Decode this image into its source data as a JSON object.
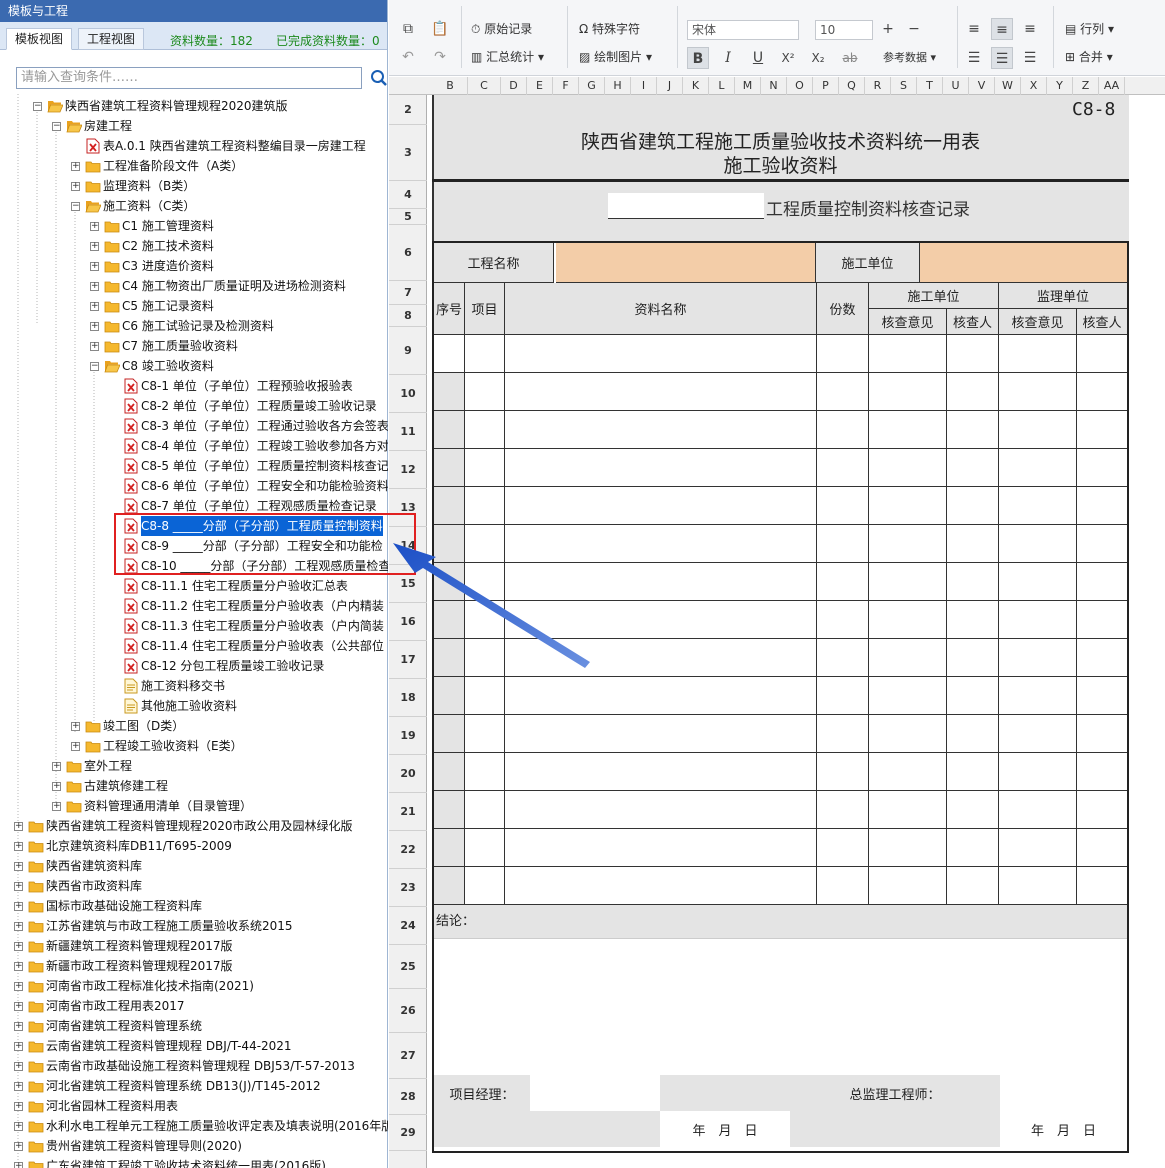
{
  "left_panel": {
    "title": "模板与工程",
    "tabs": [
      "模板视图",
      "工程视图"
    ],
    "data_count": "资料数量：182",
    "done_count": "已完成资料数量：0",
    "search_placeholder": "请输入查询条件……"
  },
  "tree": [
    {
      "label": "陕西省建筑工程资料管理规程2020建筑版",
      "level": 1,
      "expander": "minus",
      "icon": "folder-open"
    },
    {
      "label": "房建工程",
      "level": 2,
      "expander": "minus",
      "icon": "folder-open"
    },
    {
      "label": "表A.0.1 陕西省建筑工程资料整编目录一房建工程",
      "level": 3,
      "expander": "none",
      "icon": "doc-red"
    },
    {
      "label": "工程准备阶段文件（A类）",
      "level": 3,
      "expander": "plus",
      "icon": "folder"
    },
    {
      "label": "监理资料（B类）",
      "level": 3,
      "expander": "plus",
      "icon": "folder"
    },
    {
      "label": "施工资料（C类）",
      "level": 3,
      "expander": "minus",
      "icon": "folder-open"
    },
    {
      "label": "C1 施工管理资料",
      "level": 4,
      "expander": "plus",
      "icon": "folder"
    },
    {
      "label": "C2 施工技术资料",
      "level": 4,
      "expander": "plus",
      "icon": "folder"
    },
    {
      "label": "C3 进度造价资料",
      "level": 4,
      "expander": "plus",
      "icon": "folder"
    },
    {
      "label": "C4 施工物资出厂质量证明及进场检测资料",
      "level": 4,
      "expander": "plus",
      "icon": "folder"
    },
    {
      "label": "C5 施工记录资料",
      "level": 4,
      "expander": "plus",
      "icon": "folder"
    },
    {
      "label": "C6 施工试验记录及检测资料",
      "level": 4,
      "expander": "plus",
      "icon": "folder"
    },
    {
      "label": "C7 施工质量验收资料",
      "level": 4,
      "expander": "plus",
      "icon": "folder"
    },
    {
      "label": "C8 竣工验收资料",
      "level": 4,
      "expander": "minus",
      "icon": "folder-open"
    },
    {
      "label": "C8-1 单位（子单位）工程预验收报验表",
      "level": 5,
      "expander": "none",
      "icon": "doc-red"
    },
    {
      "label": "C8-2 单位（子单位）工程质量竣工验收记录",
      "level": 5,
      "expander": "none",
      "icon": "doc-red"
    },
    {
      "label": "C8-3 单位（子单位）工程通过验收各方会签表",
      "level": 5,
      "expander": "none",
      "icon": "doc-red"
    },
    {
      "label": "C8-4 单位（子单位）工程竣工验收参加各方对",
      "level": 5,
      "expander": "none",
      "icon": "doc-red"
    },
    {
      "label": "C8-5 单位（子单位）工程质量控制资料核查记",
      "level": 5,
      "expander": "none",
      "icon": "doc-red"
    },
    {
      "label": "C8-6 单位（子单位）工程安全和功能检验资料",
      "level": 5,
      "expander": "none",
      "icon": "doc-red"
    },
    {
      "label": "C8-7 单位（子单位）工程观感质量检查记录",
      "level": 5,
      "expander": "none",
      "icon": "doc-red"
    },
    {
      "label": "C8-8 _____分部（子分部）工程质量控制资料",
      "level": 5,
      "expander": "none",
      "icon": "doc-red",
      "selected": true
    },
    {
      "label": "C8-9 _____分部（子分部）工程安全和功能检",
      "level": 5,
      "expander": "none",
      "icon": "doc-red"
    },
    {
      "label": "C8-10 _____分部（子分部）工程观感质量检查",
      "level": 5,
      "expander": "none",
      "icon": "doc-red"
    },
    {
      "label": "C8-11.1 住宅工程质量分户验收汇总表",
      "level": 5,
      "expander": "none",
      "icon": "doc-red"
    },
    {
      "label": "C8-11.2 住宅工程质量分户验收表（户内精装",
      "level": 5,
      "expander": "none",
      "icon": "doc-red"
    },
    {
      "label": "C8-11.3 住宅工程质量分户验收表（户内简装",
      "level": 5,
      "expander": "none",
      "icon": "doc-red"
    },
    {
      "label": "C8-11.4 住宅工程质量分户验收表（公共部位",
      "level": 5,
      "expander": "none",
      "icon": "doc-red"
    },
    {
      "label": "C8-12 分包工程质量竣工验收记录",
      "level": 5,
      "expander": "none",
      "icon": "doc-red"
    },
    {
      "label": "施工资料移交书",
      "level": 5,
      "expander": "none",
      "icon": "doc-yellow"
    },
    {
      "label": "其他施工验收资料",
      "level": 5,
      "expander": "none",
      "icon": "doc-yellow"
    },
    {
      "label": "竣工图（D类）",
      "level": 3,
      "expander": "plus",
      "icon": "folder"
    },
    {
      "label": "工程竣工验收资料（E类）",
      "level": 3,
      "expander": "plus",
      "icon": "folder"
    },
    {
      "label": "室外工程",
      "level": 2,
      "expander": "plus",
      "icon": "folder"
    },
    {
      "label": "古建筑修建工程",
      "level": 2,
      "expander": "plus",
      "icon": "folder"
    },
    {
      "label": "资料管理通用清单（目录管理）",
      "level": 2,
      "expander": "plus",
      "icon": "folder"
    },
    {
      "label": "陕西省建筑工程资料管理规程2020市政公用及园林绿化版",
      "level": 0,
      "expander": "plus",
      "icon": "folder"
    },
    {
      "label": "北京建筑资料库DB11/T695-2009",
      "level": 0,
      "expander": "plus",
      "icon": "folder"
    },
    {
      "label": "陕西省建筑资料库",
      "level": 0,
      "expander": "plus",
      "icon": "folder"
    },
    {
      "label": "陕西省市政资料库",
      "level": 0,
      "expander": "plus",
      "icon": "folder"
    },
    {
      "label": "国标市政基础设施工程资料库",
      "level": 0,
      "expander": "plus",
      "icon": "folder"
    },
    {
      "label": "江苏省建筑与市政工程施工质量验收系统2015",
      "level": 0,
      "expander": "plus",
      "icon": "folder"
    },
    {
      "label": "新疆建筑工程资料管理规程2017版",
      "level": 0,
      "expander": "plus",
      "icon": "folder"
    },
    {
      "label": "新疆市政工程资料管理规程2017版",
      "level": 0,
      "expander": "plus",
      "icon": "folder"
    },
    {
      "label": "河南省市政工程标准化技术指南(2021)",
      "level": 0,
      "expander": "plus",
      "icon": "folder"
    },
    {
      "label": "河南省市政工程用表2017",
      "level": 0,
      "expander": "plus",
      "icon": "folder"
    },
    {
      "label": "河南省建筑工程资料管理系统",
      "level": 0,
      "expander": "plus",
      "icon": "folder"
    },
    {
      "label": "云南省建筑工程资料管理规程 DBJ/T-44-2021",
      "level": 0,
      "expander": "plus",
      "icon": "folder"
    },
    {
      "label": "云南省市政基础设施工程资料管理规程 DBJ53/T-57-2013",
      "level": 0,
      "expander": "plus",
      "icon": "folder"
    },
    {
      "label": "河北省建筑工程资料管理系统 DB13(J)/T145-2012",
      "level": 0,
      "expander": "plus",
      "icon": "folder"
    },
    {
      "label": "河北省园林工程资料用表",
      "level": 0,
      "expander": "plus",
      "icon": "folder"
    },
    {
      "label": "水利水电工程单元工程施工质量验收评定表及填表说明(2016年版",
      "level": 0,
      "expander": "plus",
      "icon": "folder"
    },
    {
      "label": "贵州省建筑工程资料管理导则(2020)",
      "level": 0,
      "expander": "plus",
      "icon": "folder"
    },
    {
      "label": "广东省建筑工程竣工验收技术资料统一用表(2016版)",
      "level": 0,
      "expander": "plus",
      "icon": "folder"
    }
  ],
  "toolbar": {
    "original_record": "原始记录",
    "special_char": "特殊字符",
    "summary_stats": "汇总统计",
    "draw_image": "绘制图片",
    "font_name": "宋体",
    "font_size": "10",
    "reference_data": "参考数据",
    "row_col": "行列",
    "merge": "合并",
    "bold": "B",
    "italic": "I",
    "underline": "U",
    "superscript": "X²",
    "subscript": "X₂",
    "strike": "ab"
  },
  "columns": [
    "B",
    "C",
    "D",
    "E",
    "F",
    "G",
    "H",
    "I",
    "J",
    "K",
    "L",
    "M",
    "N",
    "O",
    "P",
    "Q",
    "R",
    "S",
    "T",
    "U",
    "V",
    "W",
    "X",
    "Y",
    "Z",
    "AA"
  ],
  "rows": [
    "2",
    "3",
    "4",
    "5",
    "6",
    "7",
    "8",
    "9",
    "10",
    "11",
    "12",
    "13",
    "14",
    "15",
    "16",
    "17",
    "18",
    "19",
    "20",
    "21",
    "22",
    "23",
    "24",
    "25",
    "26",
    "27",
    "28",
    "29"
  ],
  "sheet": {
    "code": "C8-8",
    "title1": "陕西省建筑工程施工质量验收技术资料统一用表",
    "title2": "施工验收资料",
    "subtitle": "工程质量控制资料核查记录",
    "project_name_label": "工程名称",
    "construction_unit_label": "施工单位",
    "hdr_seq": "序号",
    "hdr_item": "项目",
    "hdr_doc_name": "资料名称",
    "hdr_copies": "份数",
    "hdr_construction_unit": "施工单位",
    "hdr_supervision_unit": "监理单位",
    "hdr_check_opinion": "核查意见",
    "hdr_checker": "核查人",
    "conclusion_label": "结论：",
    "project_manager_label": "项目经理：",
    "chief_supervisor_label": "总监理工程师：",
    "date_label": "年　月　日"
  }
}
